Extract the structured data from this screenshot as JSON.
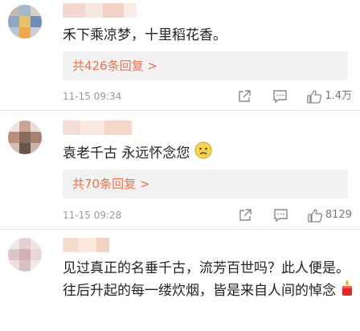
{
  "comments": [
    {
      "text": "禾下乘凉梦，十里稻花香。",
      "replies": "共426条回复 >",
      "time": "11-15 09:34",
      "likes": "1.4万",
      "avatar_icon": "pixelated-avatar"
    },
    {
      "text": "袁老千古 永远怀念您",
      "emoji": "sad-face-emoji",
      "replies": "共70条回复 >",
      "time": "11-15 09:28",
      "likes": "8129",
      "avatar_icon": "pixelated-avatar"
    },
    {
      "text": "见过真正的名垂千古，流芳百世吗？此人便是。往后升起的每一缕炊烟，皆是来自人间的悼念",
      "emoji": "candle-emoji",
      "avatar_icon": "pixelated-avatar"
    }
  ],
  "colors": {
    "accent": "#eb7350",
    "meta": "#999999",
    "reply_bg": "#f2f2f2"
  }
}
